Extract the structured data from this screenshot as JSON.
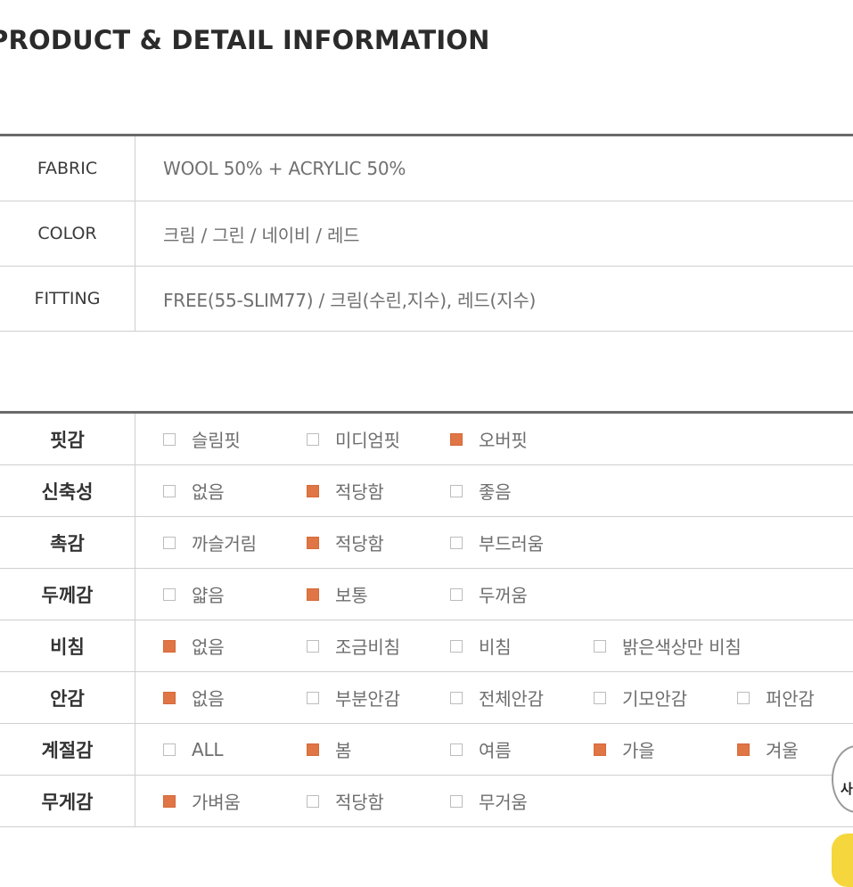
{
  "header": {
    "title": "PRODUCT & DETAIL INFORMATION"
  },
  "info": [
    {
      "label": "FABRIC",
      "value": "WOOL 50% + ACRYLIC 50%"
    },
    {
      "label": "COLOR",
      "value": "크림 / 그린 / 네이비 / 레드"
    },
    {
      "label": "FITTING",
      "value": "FREE(55-SLIM77) / 크림(수린,지수), 레드(지수)"
    }
  ],
  "specs": [
    {
      "label": "핏감",
      "options": [
        {
          "text": "슬림핏",
          "checked": false
        },
        {
          "text": "미디엄핏",
          "checked": false
        },
        {
          "text": "오버핏",
          "checked": true
        }
      ]
    },
    {
      "label": "신축성",
      "options": [
        {
          "text": "없음",
          "checked": false
        },
        {
          "text": "적당함",
          "checked": true
        },
        {
          "text": "좋음",
          "checked": false
        }
      ]
    },
    {
      "label": "촉감",
      "options": [
        {
          "text": "까슬거림",
          "checked": false
        },
        {
          "text": "적당함",
          "checked": true
        },
        {
          "text": "부드러움",
          "checked": false
        }
      ]
    },
    {
      "label": "두께감",
      "options": [
        {
          "text": "얇음",
          "checked": false
        },
        {
          "text": "보통",
          "checked": true
        },
        {
          "text": "두꺼움",
          "checked": false
        }
      ]
    },
    {
      "label": "비침",
      "options": [
        {
          "text": "없음",
          "checked": true
        },
        {
          "text": "조금비침",
          "checked": false
        },
        {
          "text": "비침",
          "checked": false
        },
        {
          "text": "밝은색상만 비침",
          "checked": false
        }
      ]
    },
    {
      "label": "안감",
      "options": [
        {
          "text": "없음",
          "checked": true
        },
        {
          "text": "부분안감",
          "checked": false
        },
        {
          "text": "전체안감",
          "checked": false
        },
        {
          "text": "기모안감",
          "checked": false
        },
        {
          "text": "퍼안감",
          "checked": false
        }
      ]
    },
    {
      "label": "계절감",
      "options": [
        {
          "text": "ALL",
          "checked": false
        },
        {
          "text": "봄",
          "checked": true
        },
        {
          "text": "여름",
          "checked": false
        },
        {
          "text": "가을",
          "checked": true
        },
        {
          "text": "겨울",
          "checked": true
        }
      ]
    },
    {
      "label": "무게감",
      "options": [
        {
          "text": "가벼움",
          "checked": true
        },
        {
          "text": "적당함",
          "checked": false
        },
        {
          "text": "무거움",
          "checked": false
        }
      ]
    }
  ],
  "floating": {
    "circle_label": "사",
    "accent": "#f5d63d"
  },
  "colors": {
    "checked": "#e07545",
    "border": "#cfcfcf",
    "rule": "#6a6a6a"
  }
}
